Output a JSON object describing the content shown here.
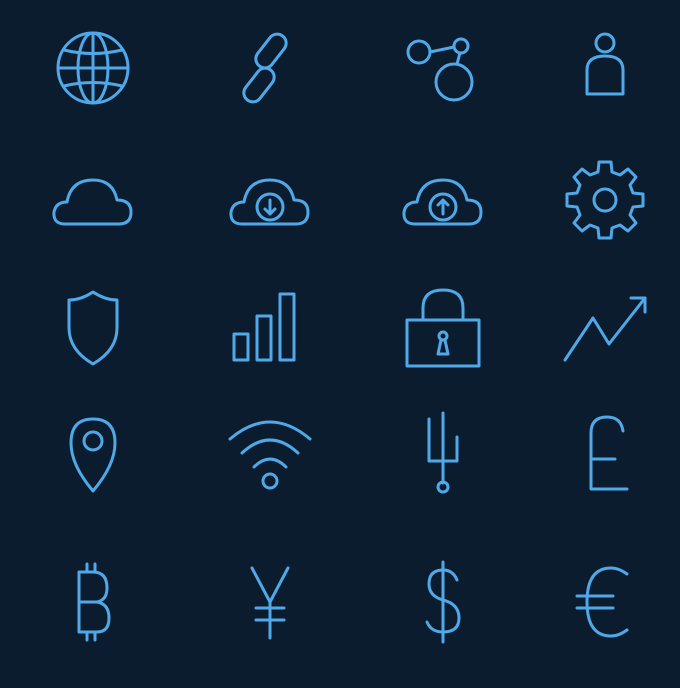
{
  "colors": {
    "background": "#0b1c2e",
    "icon_stroke": "#4fa8e8"
  },
  "icons": [
    "globe-icon",
    "link-icon",
    "share-nodes-icon",
    "user-icon",
    "cloud-icon",
    "cloud-download-icon",
    "cloud-upload-icon",
    "gear-icon",
    "shield-icon",
    "bar-chart-icon",
    "lock-icon",
    "trend-up-icon",
    "location-pin-icon",
    "wifi-icon",
    "trident-icon",
    "pound-icon",
    "bitcoin-icon",
    "yen-icon",
    "dollar-icon",
    "euro-icon"
  ]
}
